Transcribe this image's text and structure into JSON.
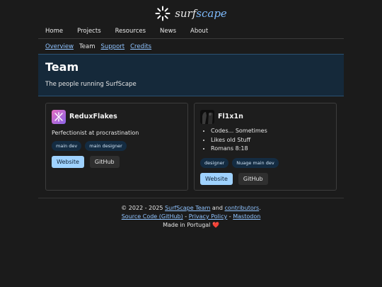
{
  "site": {
    "logo_icon": "sparkle-logo-icon",
    "logo_prefix": "surf",
    "logo_suffix": "scape"
  },
  "nav": {
    "items": [
      {
        "label": "Home"
      },
      {
        "label": "Projects"
      },
      {
        "label": "Resources"
      },
      {
        "label": "News"
      },
      {
        "label": "About"
      }
    ]
  },
  "subnav": {
    "items": [
      {
        "label": "Overview"
      },
      {
        "label": "Team"
      },
      {
        "label": "Support"
      },
      {
        "label": "Credits"
      }
    ],
    "current": "Team"
  },
  "hero": {
    "title": "Team",
    "subtitle": "The people running SurfScape"
  },
  "members": [
    {
      "name": "ReduxFlakes",
      "avatar_icon": "snowflake-avatar-icon",
      "description": "Perfectionist at procrastination",
      "tags": [
        "main dev",
        "main designer"
      ],
      "buttons": {
        "website": "Website",
        "github": "GitHub"
      }
    },
    {
      "name": "Fl1x1n",
      "avatar_icon": "dark-figure-avatar-icon",
      "bullets": [
        "Codes... Sometimes",
        "Likes old Stuff",
        "Romans 8:18"
      ],
      "tags": [
        "designer",
        "Nuage main dev"
      ],
      "buttons": {
        "website": "Website",
        "github": "GitHub"
      }
    }
  ],
  "footer": {
    "copyright": "© 2022 - 2025",
    "team_link": "SurfScape Team",
    "and": "and",
    "contributors_link": "contributors",
    "period": ".",
    "source_link": "Source Code (GitHub)",
    "sep": " - ",
    "privacy_link": "Privacy Policy",
    "mastodon_link": "Mastodon",
    "made_in": "Made in Portugal",
    "heart": "❤️"
  },
  "colors": {
    "accent": "#8fc3ff",
    "hero_bg": "#15293a",
    "primary_button": "#9fd2ff"
  }
}
